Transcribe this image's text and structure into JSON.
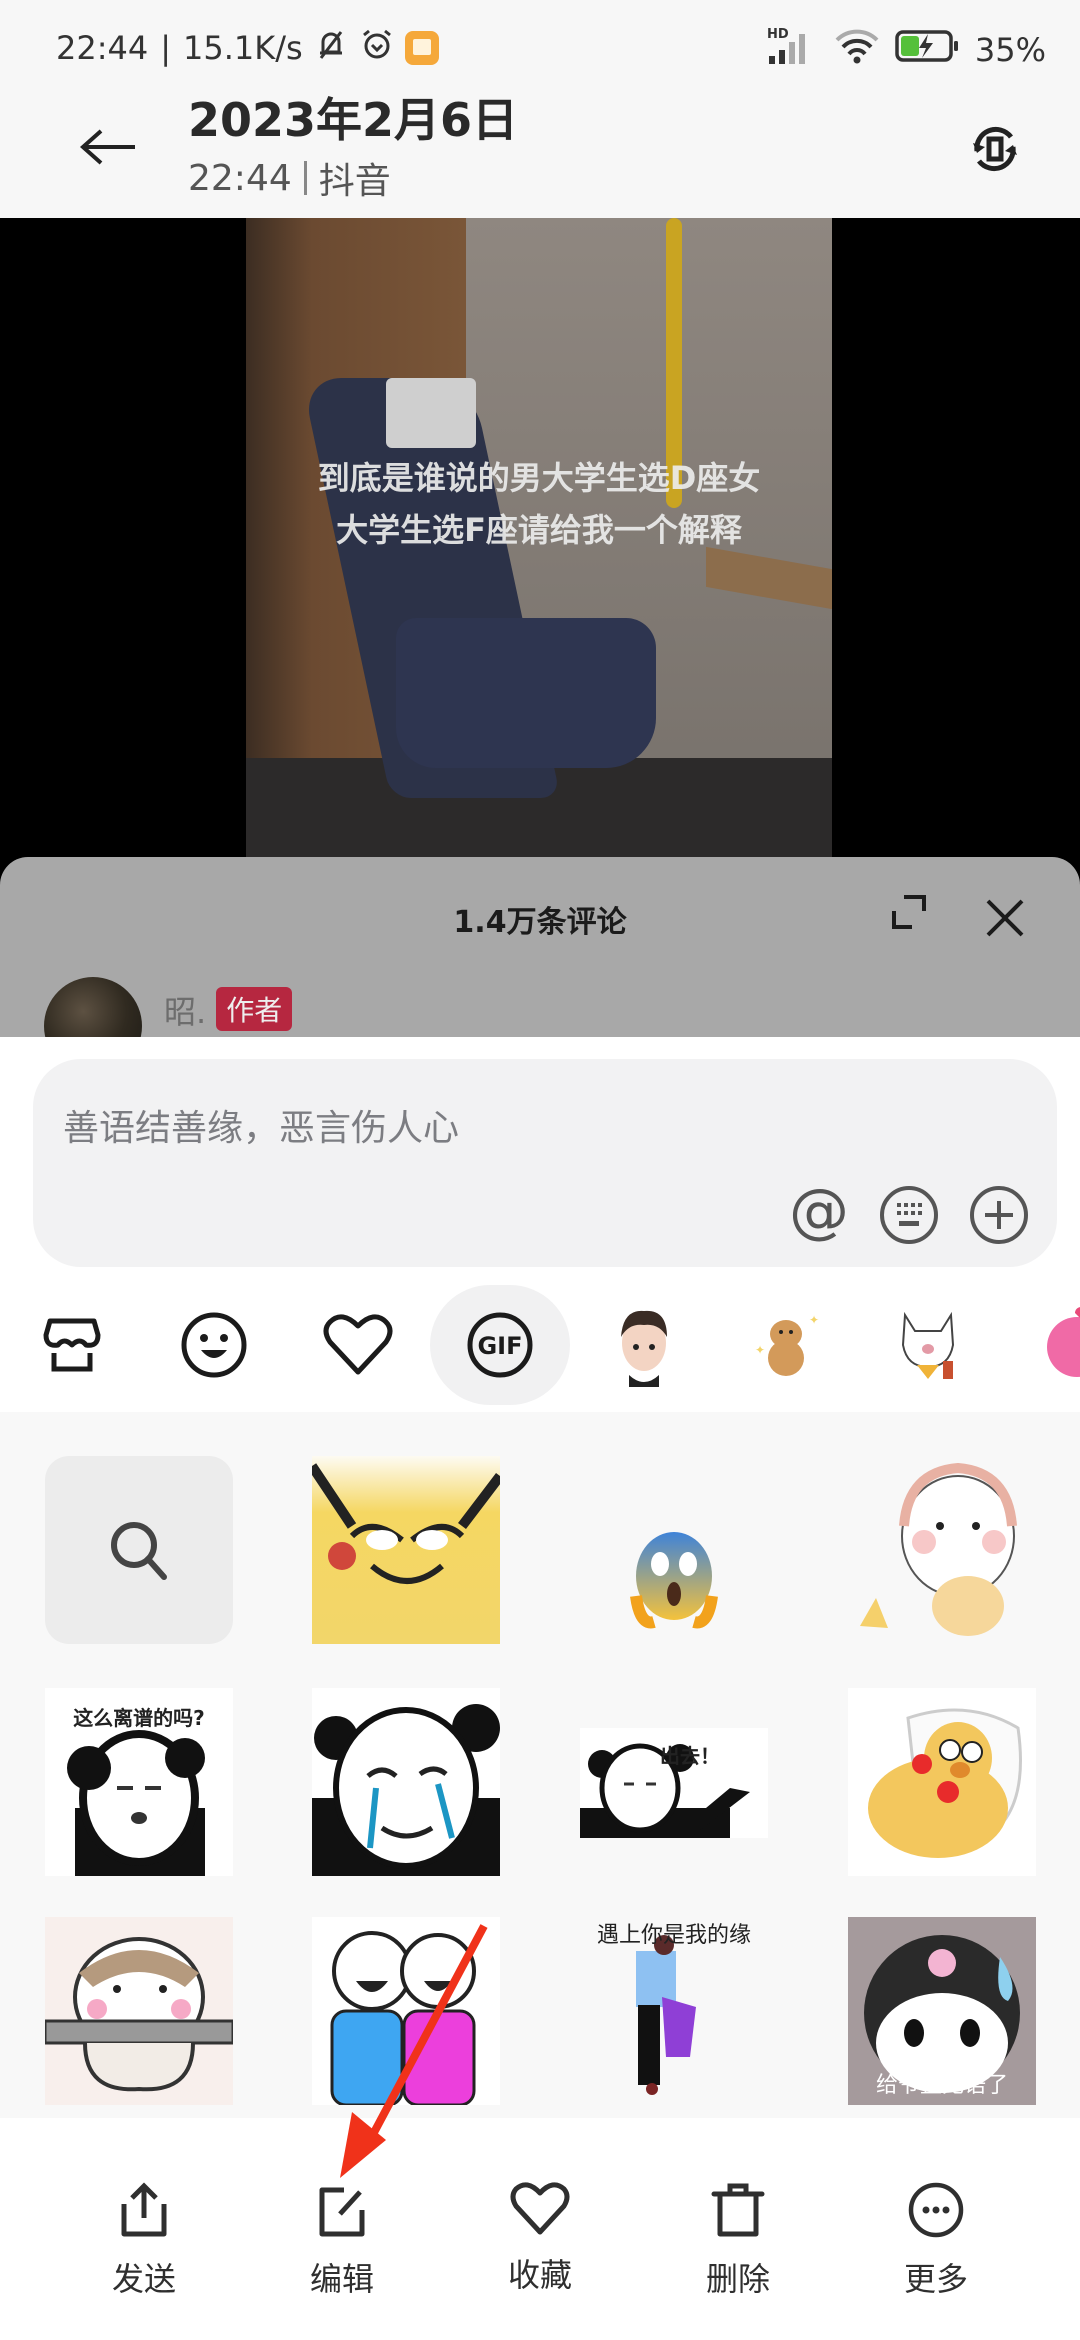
{
  "status_bar": {
    "time": "22:44",
    "net_speed": "15.1K/s",
    "network_label": "HD",
    "battery": "35%",
    "icons": [
      "mute-bell-icon",
      "alarm-icon",
      "app-notification-icon",
      "signal-icon",
      "wifi-icon",
      "battery-charging-icon"
    ]
  },
  "header": {
    "title": "2023年2月6日",
    "time": "22:44",
    "source": "抖音",
    "back_icon": "arrow-left-icon",
    "rotate_icon": "rotate-screen-icon"
  },
  "video": {
    "caption_line1": "到底是谁说的男大学生选D座女",
    "caption_line2": "大学生选F座请给我一个解释"
  },
  "comments": {
    "title": "1.4万条评论",
    "first_comment": {
      "username": "昭.",
      "badge": "作者"
    }
  },
  "input": {
    "placeholder": "善语结善缘，恶言伤人心",
    "icons": [
      "at-icon",
      "keyboard-icon",
      "plus-icon"
    ]
  },
  "emoji_tabs": [
    {
      "name": "store-icon",
      "active": false
    },
    {
      "name": "smiley-icon",
      "active": false
    },
    {
      "name": "heart-icon",
      "active": false
    },
    {
      "name": "gif-icon",
      "label": "GIF",
      "active": true
    },
    {
      "name": "avatar-sticker-pack",
      "active": false
    },
    {
      "name": "bear-sticker-pack",
      "active": false
    },
    {
      "name": "dog-sticker-pack",
      "active": false
    },
    {
      "name": "pink-sticker-pack",
      "active": false
    }
  ],
  "stickers": [
    {
      "name": "search-sticker",
      "label": ""
    },
    {
      "name": "pikachu-smirk-sticker",
      "label": ""
    },
    {
      "name": "scream-emoji-sticker",
      "label": ""
    },
    {
      "name": "cat-snack-sticker",
      "label": ""
    },
    {
      "name": "panda-question-sticker",
      "label": "这么离谱的吗?"
    },
    {
      "name": "panda-crying-sticker",
      "label": ""
    },
    {
      "name": "panda-get-out-sticker",
      "label": "出去！"
    },
    {
      "name": "duck-pillow-sticker",
      "label": ""
    },
    {
      "name": "hamster-bar-sticker",
      "label": ""
    },
    {
      "name": "two-friends-sticker",
      "label": ""
    },
    {
      "name": "dancing-couple-sticker",
      "label": "遇上你是我的缘"
    },
    {
      "name": "kuromi-speechless-sticker",
      "label": "给爷整无语了"
    }
  ],
  "actions": [
    {
      "name": "send",
      "label": "发送"
    },
    {
      "name": "edit",
      "label": "编辑"
    },
    {
      "name": "favorite",
      "label": "收藏"
    },
    {
      "name": "delete",
      "label": "删除"
    },
    {
      "name": "more",
      "label": "更多"
    }
  ],
  "annotation": {
    "arrow_color": "#f0321a",
    "points_to": "edit"
  }
}
